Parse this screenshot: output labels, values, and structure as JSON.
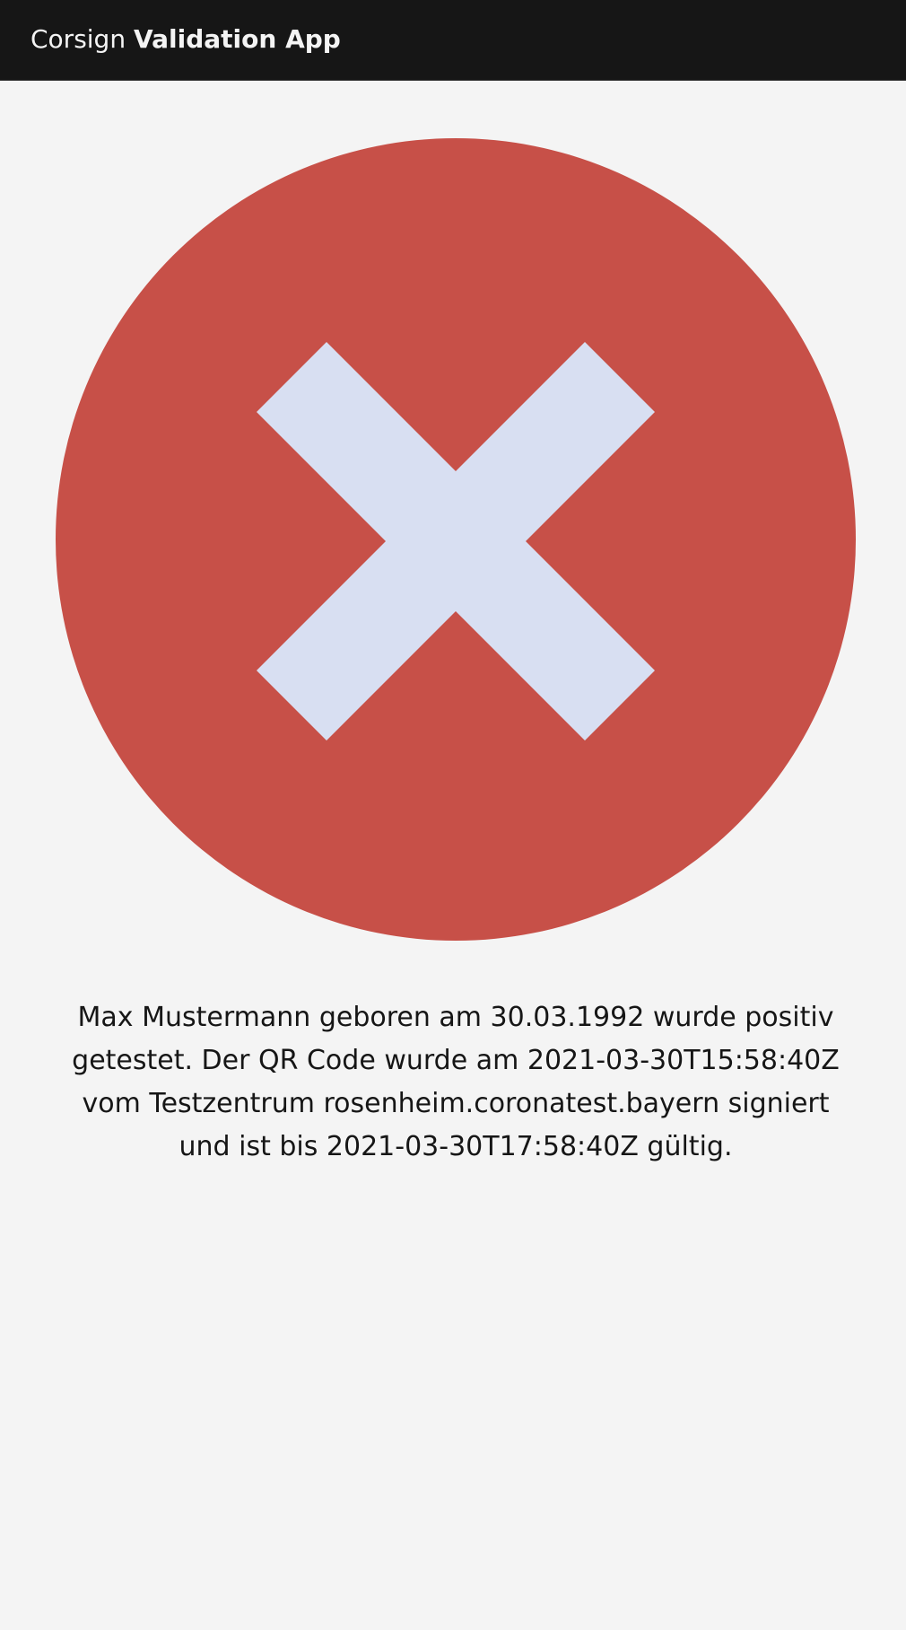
{
  "app": {
    "brand_prefix": "Corsign",
    "brand_name": "Validation App"
  },
  "result": {
    "status": "invalid",
    "icon": "x-mark-icon",
    "icon_color": "#c75048",
    "mark_color": "#d8dff2",
    "message": "Max Mustermann geboren am 30.03.1992 wurde positiv getestet. Der QR Code wurde am 2021-03-30T15:58:40Z vom Testzentrum rosenheim.coronatest.bayern signiert und ist bis 2021-03-30T17:58:40Z gültig."
  },
  "colors": {
    "header_bg": "#161616",
    "page_bg": "#f4f4f4",
    "header_text": "#f4f4f4",
    "body_text": "#161616"
  }
}
